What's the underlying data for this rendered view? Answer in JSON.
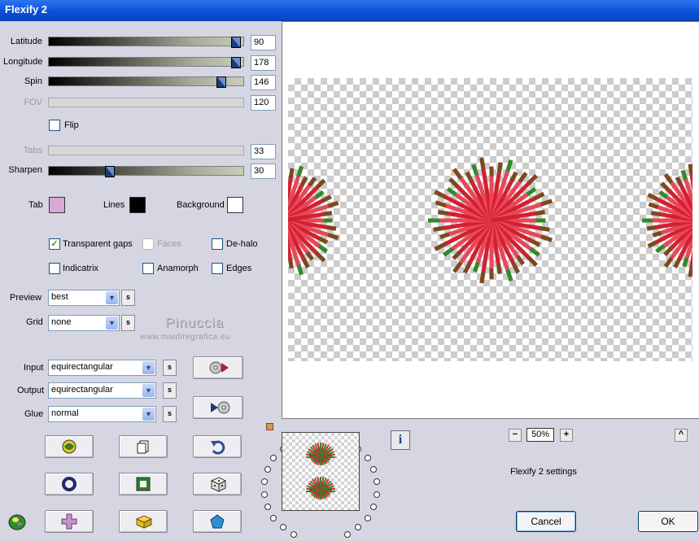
{
  "window": {
    "title": "Flexify 2"
  },
  "params": {
    "latitude": {
      "label": "Latitude",
      "value": "90",
      "fraction": 0.98
    },
    "longitude": {
      "label": "Longitude",
      "value": "178",
      "fraction": 0.98
    },
    "spin": {
      "label": "Spin",
      "value": "146",
      "fraction": 0.9
    },
    "fov": {
      "label": "FOV",
      "value": "120"
    },
    "flip": {
      "label": "Flip",
      "checked": false
    },
    "tabs": {
      "label": "Tabs",
      "value": "33"
    },
    "sharpen": {
      "label": "Sharpen",
      "value": "30",
      "fraction": 0.3
    }
  },
  "colors": {
    "tab_label": "Tab",
    "tab_color": "#d9a8d9",
    "lines_label": "Lines",
    "lines_color": "#000000",
    "background_label": "Background",
    "background_color": "#ffffff"
  },
  "options": {
    "transparent_gaps": {
      "label": "Transparent gaps",
      "checked": true
    },
    "faces": {
      "label": "Faces",
      "checked": false
    },
    "dehalo": {
      "label": "De-halo",
      "checked": false
    },
    "indicatrix": {
      "label": "Indicatrix",
      "checked": false
    },
    "anamorph": {
      "label": "Anamorph",
      "checked": false
    },
    "edges": {
      "label": "Edges",
      "checked": false
    }
  },
  "dropdowns": {
    "preview": {
      "label": "Preview",
      "value": "best"
    },
    "grid": {
      "label": "Grid",
      "value": "none"
    },
    "input": {
      "label": "Input",
      "value": "equirectangular"
    },
    "output": {
      "label": "Output",
      "value": "equirectangular"
    },
    "glue": {
      "label": "Glue",
      "value": "normal"
    },
    "s_label": "s"
  },
  "watermark": {
    "name": "Pinuccia",
    "url": "www.maidiregrafica.eu"
  },
  "zoom": {
    "value": "50%",
    "minus": "−",
    "plus": "+"
  },
  "info_label": "i",
  "collapse_label": "^",
  "settings_label": "Flexify 2 settings",
  "buttons": {
    "cancel": "Cancel",
    "ok": "OK"
  }
}
